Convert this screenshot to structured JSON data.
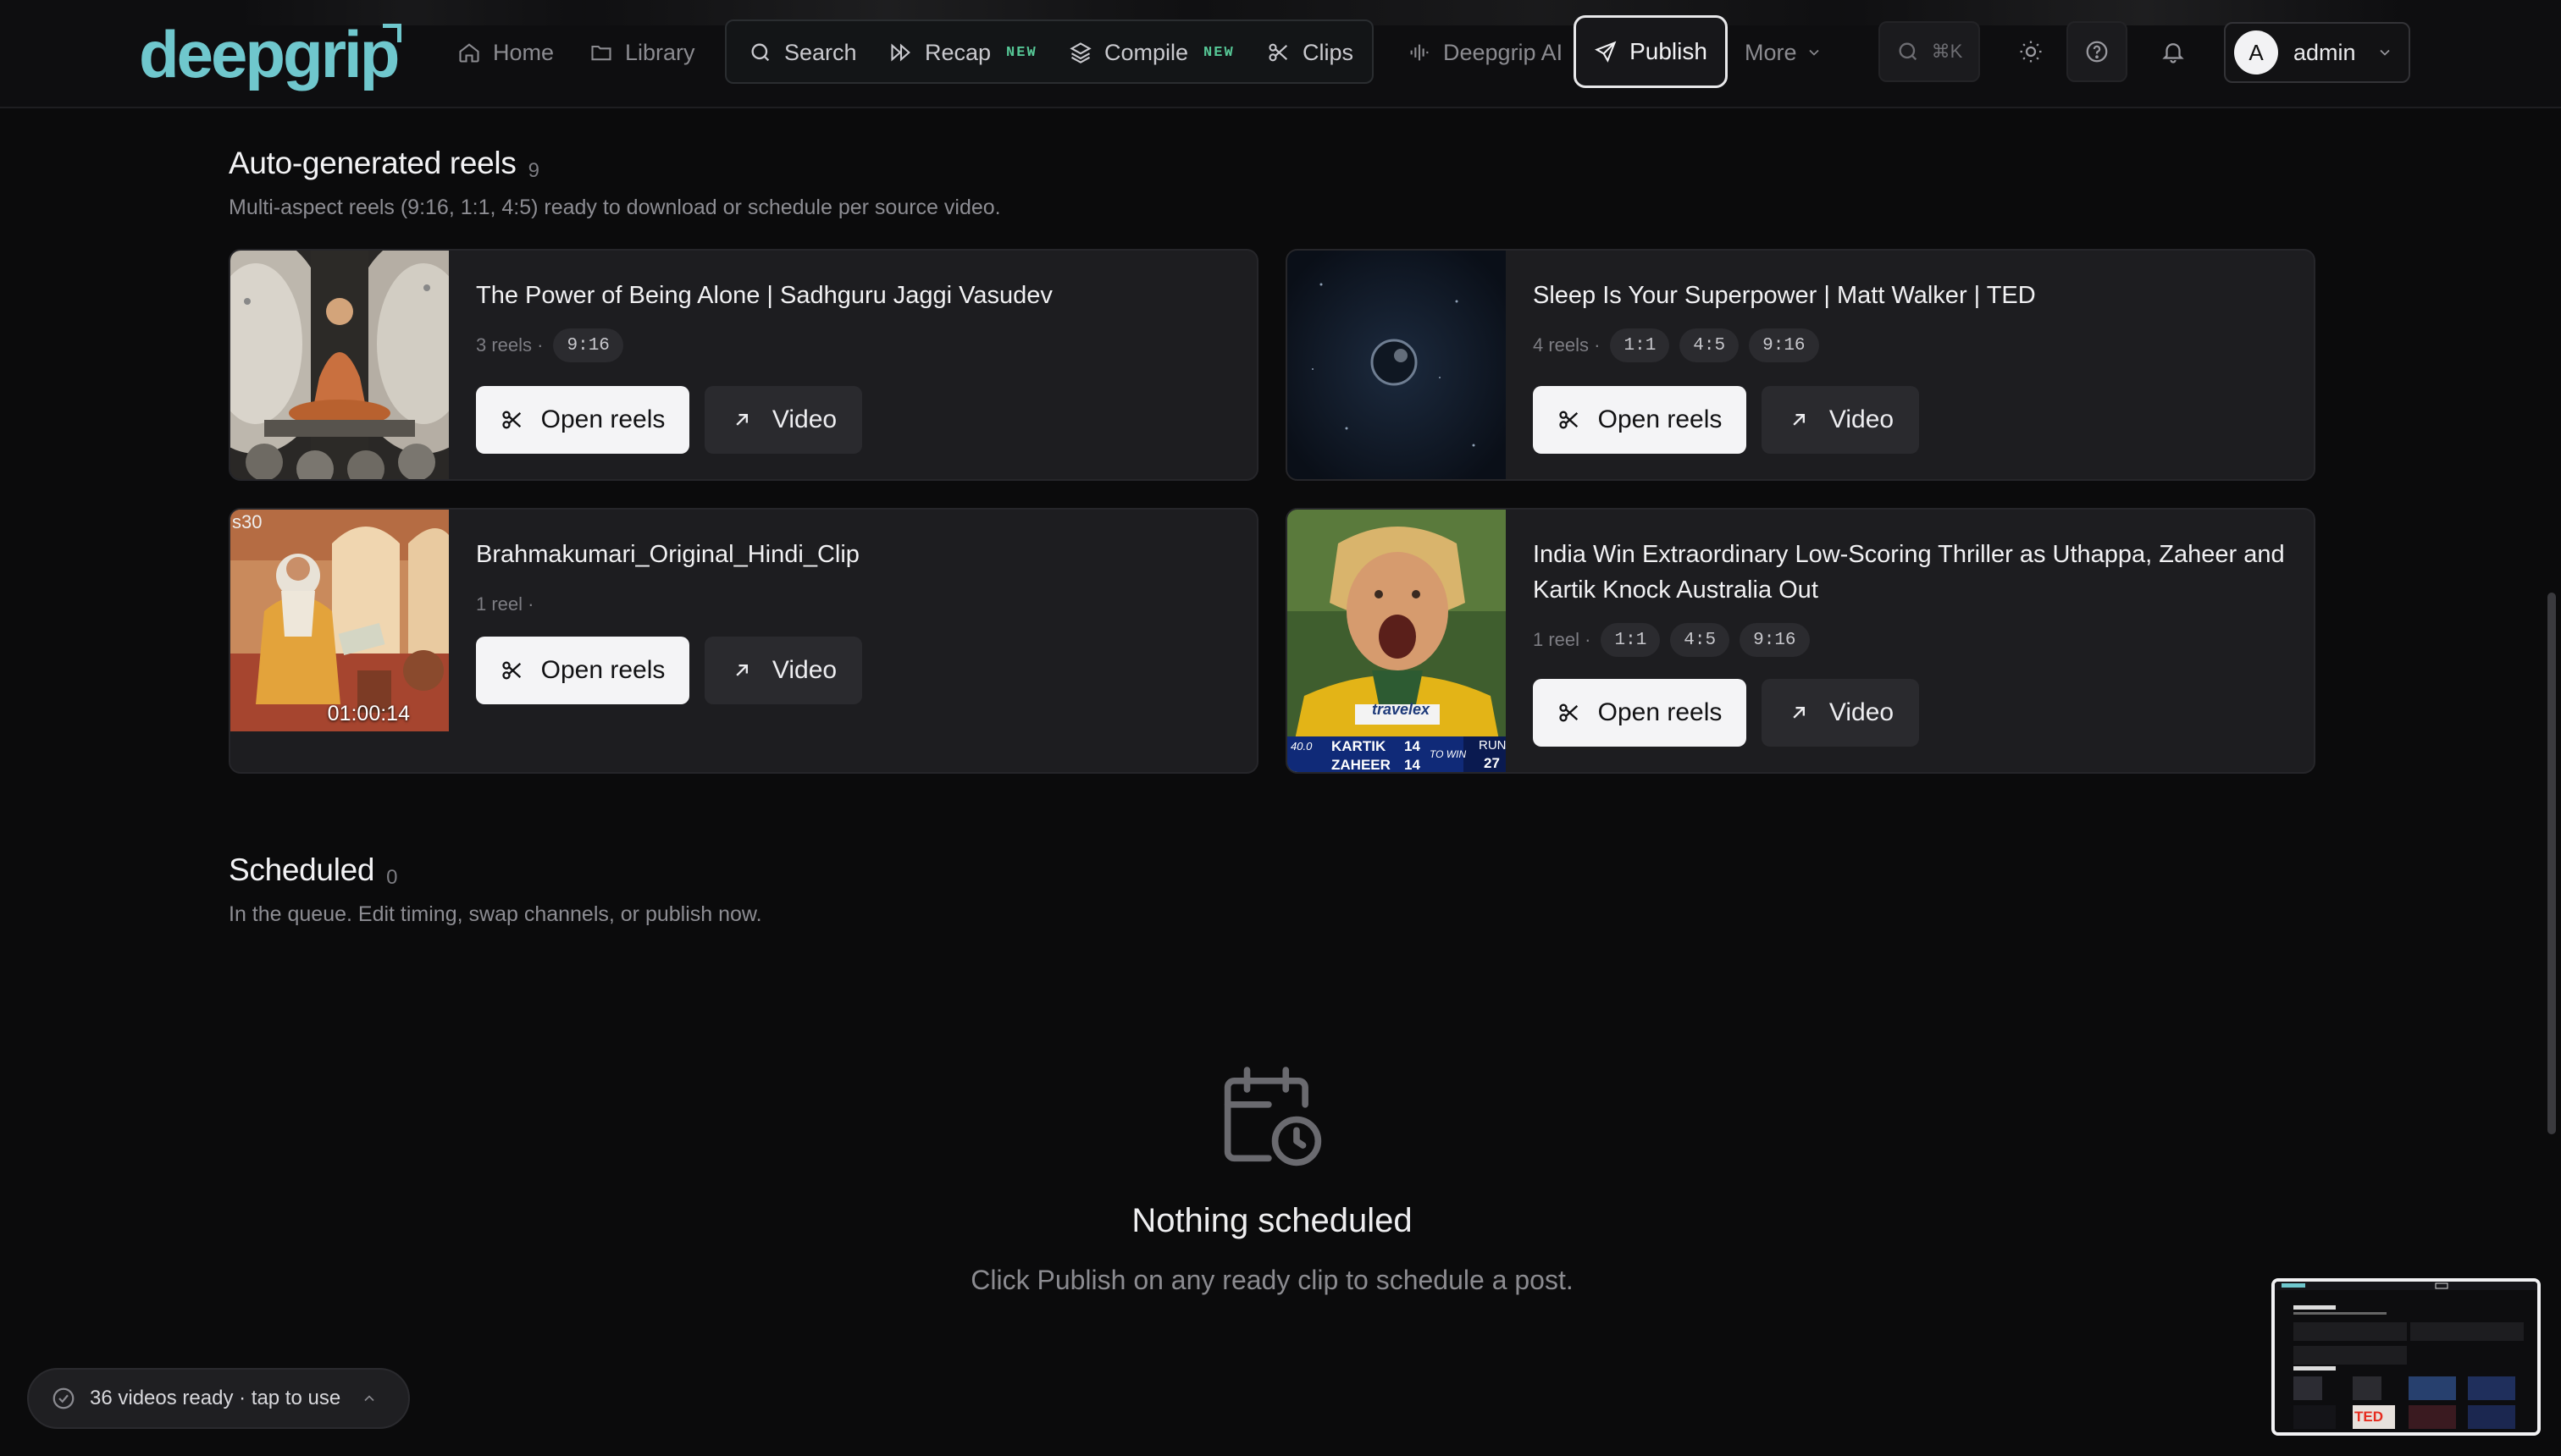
{
  "nav": {
    "logo": "deepgrip",
    "home": "Home",
    "library": "Library",
    "search": "Search",
    "recap": "Recap",
    "recap_badge": "NEW",
    "compile": "Compile",
    "compile_badge": "NEW",
    "clips": "Clips",
    "ai": "Deepgrip AI",
    "publish": "Publish",
    "more": "More",
    "shortcut": "⌘K",
    "user_initial": "A",
    "user_name": "admin"
  },
  "reels_section": {
    "title": "Auto-generated reels",
    "count": "9",
    "subtitle": "Multi-aspect reels (9:16, 1:1, 4:5) ready to download or schedule per source video.",
    "open_label": "Open reels",
    "video_label": "Video",
    "cards": [
      {
        "title": "The Power of Being Alone | Sadhguru Jaggi Vasudev",
        "reels": "3 reels ·",
        "aspects": [
          "9:16"
        ]
      },
      {
        "title": "Sleep Is Your Superpower | Matt Walker | TED",
        "reels": "4 reels ·",
        "aspects": [
          "1:1",
          "4:5",
          "9:16"
        ]
      },
      {
        "title": "Brahmakumari_Original_Hindi_Clip",
        "reels": "1 reel ·",
        "aspects": [],
        "duration": "01:00:14",
        "corner": "s30"
      },
      {
        "title": "India Win Extraordinary Low-Scoring Thriller as Uthappa, Zaheer and Kartik Knock Australia Out",
        "reels": "1 reel ·",
        "aspects": [
          "1:1",
          "4:5",
          "9:16"
        ],
        "score": {
          "row1_name": "KARTIK",
          "row1_val": "14",
          "row2_name": "ZAHEER",
          "row2_val": "14",
          "over": "40.0",
          "to_win": "TO WIN",
          "runs_label": "RUN",
          "runs_val": "27",
          "sponsor": "travelex"
        }
      }
    ]
  },
  "scheduled_section": {
    "title": "Scheduled",
    "count": "0",
    "subtitle": "In the queue. Edit timing, swap channels, or publish now.",
    "empty_title": "Nothing scheduled",
    "empty_subtitle": "Click Publish on any ready clip to schedule a post."
  },
  "toast": {
    "text": "36 videos ready · tap to use"
  },
  "minimap": {
    "label": "TED"
  }
}
